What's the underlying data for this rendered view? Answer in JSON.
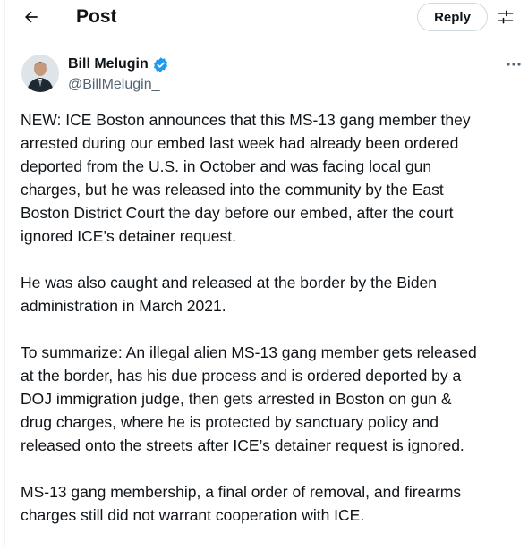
{
  "header": {
    "title": "Post",
    "reply_label": "Reply"
  },
  "author": {
    "name": "Bill Melugin",
    "handle": "@BillMelugin_",
    "verified": true
  },
  "post": {
    "paragraphs": [
      "NEW: ICE Boston announces that this MS-13 gang member they\narrested during our embed last week had already been ordered\ndeported from the U.S. in October and was facing local gun\ncharges, but he was released into the community by the East\nBoston District Court the day before our embed, after the court\nignored ICE’s detainer request.",
      "He was also caught and released at the border by the Biden\nadministration in March 2021.",
      "To summarize: An illegal alien MS-13 gang member gets released\nat the border, has his due process and is ordered deported by a\nDOJ immigration judge, then gets arrested in Boston on gun &\ndrug charges, where he is protected by sanctuary policy and\nreleased onto the streets after ICE’s detainer request is ignored.",
      "MS-13 gang membership, a final order of removal, and firearms\ncharges still did not warrant cooperation with ICE."
    ]
  },
  "icons": {
    "back": "arrow-left-icon",
    "adjust": "sliders-icon",
    "verified": "verified-badge-icon",
    "more": "more-horizontal-icon"
  },
  "colors": {
    "text": "#0f1419",
    "secondary": "#536471",
    "verified": "#1d9bf0",
    "border": "#cfd9de"
  }
}
